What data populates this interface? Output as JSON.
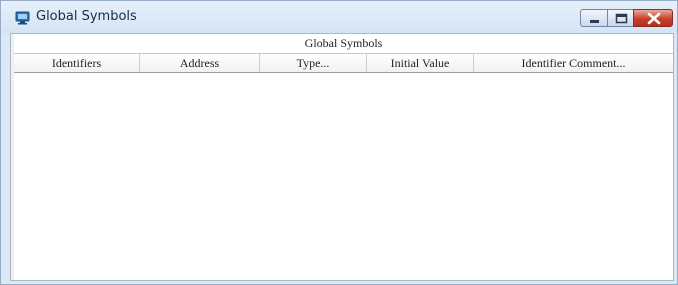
{
  "window": {
    "title": "Global Symbols",
    "icon": "monitor-icon",
    "controls": [
      "minimize-icon",
      "maximize-icon",
      "close-icon"
    ]
  },
  "table": {
    "group_header": "Global Symbols",
    "columns": [
      "Identifiers",
      "Address",
      "Type...",
      "Initial Value",
      "Identifier Comment..."
    ],
    "rows": []
  },
  "colors": {
    "frame": "#dbe8f6",
    "close_button": "#c7402c"
  }
}
